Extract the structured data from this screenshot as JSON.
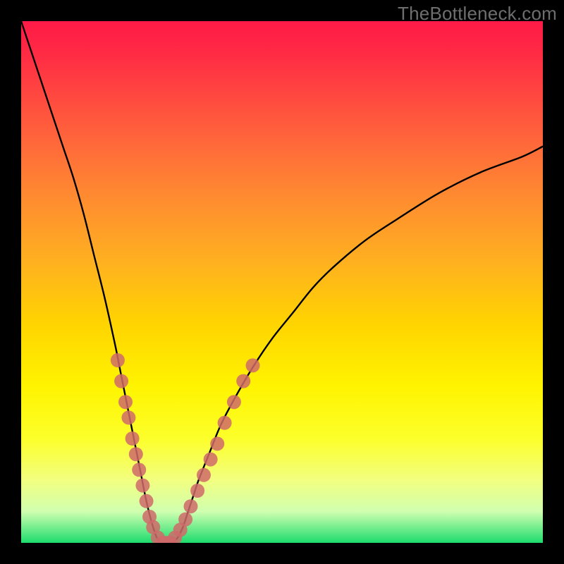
{
  "watermark": "TheBottleneck.com",
  "colors": {
    "frame": "#000000",
    "curve": "#000000",
    "marker_fill": "#cf6a6a",
    "marker_stroke": "#cf6a6a",
    "gradient_top": "#ff1a47",
    "gradient_bottom": "#1ddc6e"
  },
  "chart_data": {
    "type": "line",
    "title": "",
    "xlabel": "",
    "ylabel": "",
    "xlim": [
      0,
      100
    ],
    "ylim": [
      0,
      100
    ],
    "grid": false,
    "legend": false,
    "series": [
      {
        "name": "bottleneck-curve",
        "x": [
          0,
          2,
          4,
          6,
          8,
          10,
          12,
          14,
          16,
          18,
          19,
          20,
          21,
          22,
          23,
          24,
          25,
          26,
          27,
          28,
          29,
          30,
          31,
          32,
          33,
          34,
          36,
          38,
          40,
          44,
          48,
          52,
          56,
          60,
          66,
          72,
          80,
          88,
          96,
          100
        ],
        "y": [
          100,
          94,
          88,
          82,
          76,
          70,
          63,
          55,
          47,
          38,
          33,
          28,
          23,
          18,
          13,
          8,
          4,
          1,
          0,
          0,
          0,
          1,
          3,
          6,
          9,
          12,
          17,
          22,
          26,
          33,
          39,
          44,
          49,
          53,
          58,
          62,
          67,
          71,
          74,
          76
        ]
      }
    ],
    "markers": {
      "name": "sample-points",
      "points": [
        {
          "x": 18.5,
          "y": 35
        },
        {
          "x": 19.2,
          "y": 31
        },
        {
          "x": 20.0,
          "y": 27
        },
        {
          "x": 20.6,
          "y": 24
        },
        {
          "x": 21.3,
          "y": 20
        },
        {
          "x": 22.0,
          "y": 17
        },
        {
          "x": 22.6,
          "y": 14
        },
        {
          "x": 23.3,
          "y": 11
        },
        {
          "x": 24.0,
          "y": 8
        },
        {
          "x": 24.6,
          "y": 5
        },
        {
          "x": 25.3,
          "y": 3
        },
        {
          "x": 26.2,
          "y": 1
        },
        {
          "x": 27.0,
          "y": 0
        },
        {
          "x": 27.8,
          "y": 0
        },
        {
          "x": 28.6,
          "y": 0
        },
        {
          "x": 29.5,
          "y": 1
        },
        {
          "x": 30.5,
          "y": 2.5
        },
        {
          "x": 31.5,
          "y": 4.5
        },
        {
          "x": 32.5,
          "y": 7
        },
        {
          "x": 33.8,
          "y": 10
        },
        {
          "x": 35.0,
          "y": 13
        },
        {
          "x": 36.3,
          "y": 16
        },
        {
          "x": 37.6,
          "y": 19
        },
        {
          "x": 39.0,
          "y": 23
        },
        {
          "x": 40.8,
          "y": 27
        },
        {
          "x": 42.6,
          "y": 31
        },
        {
          "x": 44.4,
          "y": 34
        }
      ]
    }
  }
}
